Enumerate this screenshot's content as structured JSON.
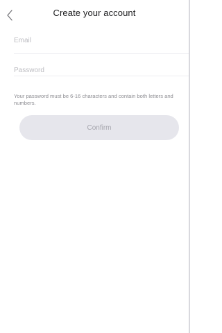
{
  "header": {
    "back_icon": "chevron-left-icon",
    "title": "Create your account"
  },
  "form": {
    "email_placeholder": "Email",
    "password_placeholder": "Password",
    "hint": "Your password must be 6-16 characters and contain both letters and numbers."
  },
  "actions": {
    "confirm_label": "Confirm"
  },
  "colors": {
    "button_bg": "#e6e6ec",
    "button_text": "#a5a5ad",
    "placeholder": "#bdbdc2",
    "hint_text": "#8e8e93"
  }
}
